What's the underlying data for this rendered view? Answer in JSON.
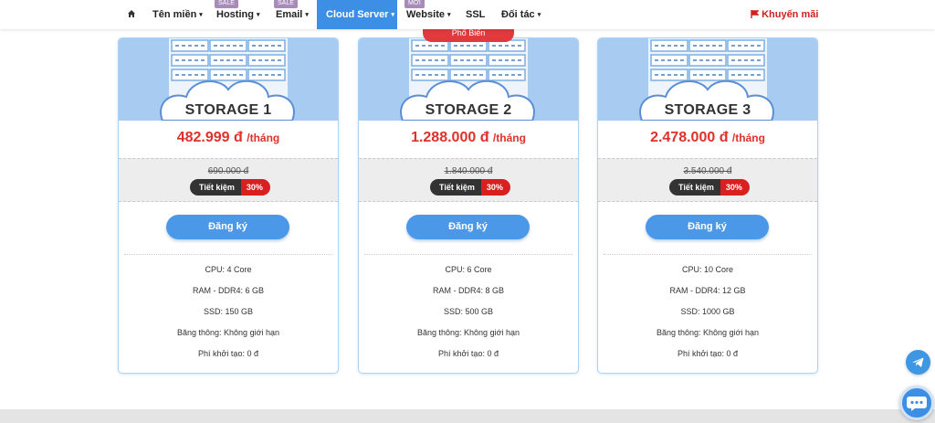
{
  "nav": {
    "items": [
      {
        "label": "Tên miền",
        "caret": "▾"
      },
      {
        "label": "Hosting",
        "caret": "▾",
        "badge": "SALE"
      },
      {
        "label": "Email",
        "caret": "▾",
        "badge": "SALE"
      },
      {
        "label": "Cloud Server",
        "caret": "▾",
        "active": true
      },
      {
        "label": "Website",
        "caret": "▾",
        "badge": "MỚI"
      },
      {
        "label": "SSL"
      },
      {
        "label": "Đối tác",
        "caret": "▾"
      }
    ],
    "promo": "Khuyến mãi",
    "home_icon": "home-icon",
    "promo_icon": "flag-icon"
  },
  "ribbon": "Phổ Biến",
  "plans": [
    {
      "name": "STORAGE 1",
      "price": "482.999 đ",
      "per": "/tháng",
      "old_price": "690.000 đ",
      "save_label": "Tiết kiệm",
      "save_pct": "30%",
      "button": "Đăng ký",
      "specs": [
        "CPU: 4 Core",
        "RAM - DDR4: 6 GB",
        "SSD: 150 GB",
        "Băng thông: Không giới hạn",
        "Phí khởi tạo: 0 đ"
      ]
    },
    {
      "name": "STORAGE 2",
      "price": "1.288.000 đ",
      "per": "/tháng",
      "old_price": "1.840.000 đ",
      "save_label": "Tiết kiệm",
      "save_pct": "30%",
      "button": "Đăng ký",
      "specs": [
        "CPU: 6 Core",
        "RAM - DDR4: 8 GB",
        "SSD: 500 GB",
        "Băng thông: Không giới hạn",
        "Phí khởi tạo: 0 đ"
      ]
    },
    {
      "name": "STORAGE 3",
      "price": "2.478.000 đ",
      "per": "/tháng",
      "old_price": "3.540.000 đ",
      "save_label": "Tiết kiệm",
      "save_pct": "30%",
      "button": "Đăng ký",
      "specs": [
        "CPU: 10 Core",
        "RAM - DDR4: 12 GB",
        "SSD: 1000 GB",
        "Băng thông: Không giới hạn",
        "Phí khởi tạo: 0 đ"
      ]
    }
  ],
  "floating": {
    "telegram_icon": "telegram-icon",
    "chat_icon": "chat-icon"
  },
  "colors": {
    "accent": "#3d8fe6",
    "price": "#e0302b",
    "save_red": "#d91f1f",
    "card_header": "#a8cbf2"
  }
}
